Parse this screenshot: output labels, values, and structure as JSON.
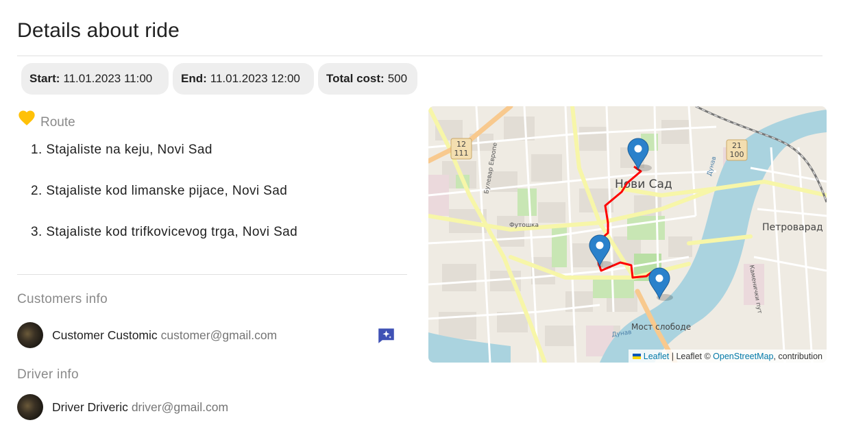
{
  "page": {
    "title": "Details about ride"
  },
  "chips": {
    "start_label": "Start:",
    "start_value": "11.01.2023 11:00",
    "end_label": "End:",
    "end_value": "11.01.2023 12:00",
    "cost_label": "Total cost:",
    "cost_value": "500"
  },
  "route": {
    "label": "Route",
    "icon": "heart-icon",
    "icon_color": "#ffc107",
    "stops": [
      "1. Stajaliste na keju, Novi Sad",
      "2. Stajaliste kod limanske pijace, Novi Sad",
      "3. Stajaliste kod trifkovicevog trga, Novi Sad"
    ]
  },
  "customers": {
    "label": "Customers info",
    "name": "Customer Customic",
    "email": "customer@gmail.com",
    "chat_icon": "chat-sparkle-icon",
    "chat_icon_color": "#3f51b5"
  },
  "driver": {
    "label": "Driver info",
    "name": "Driver Driveric",
    "email": "driver@gmail.com"
  },
  "map": {
    "city_label": "Нови Сад",
    "district_label": "Петроварад",
    "futog_label": "Футошка",
    "bulevar_label": "Булевар Европе",
    "bridge_label": "Мост слободе",
    "river_label": "Дунав",
    "danube_left_label": "Дунав",
    "kamenicki_label": "Каменички пут",
    "shield_left": [
      "12",
      "111"
    ],
    "shield_right": [
      "21",
      "100"
    ],
    "route_color": "#e00000",
    "marker_color": "#2a81cb",
    "attribution": {
      "leaflet_link": "Leaflet",
      "separator": " | Leaflet © ",
      "osm_link": "OpenStreetMap",
      "suffix": ", contribution"
    }
  }
}
